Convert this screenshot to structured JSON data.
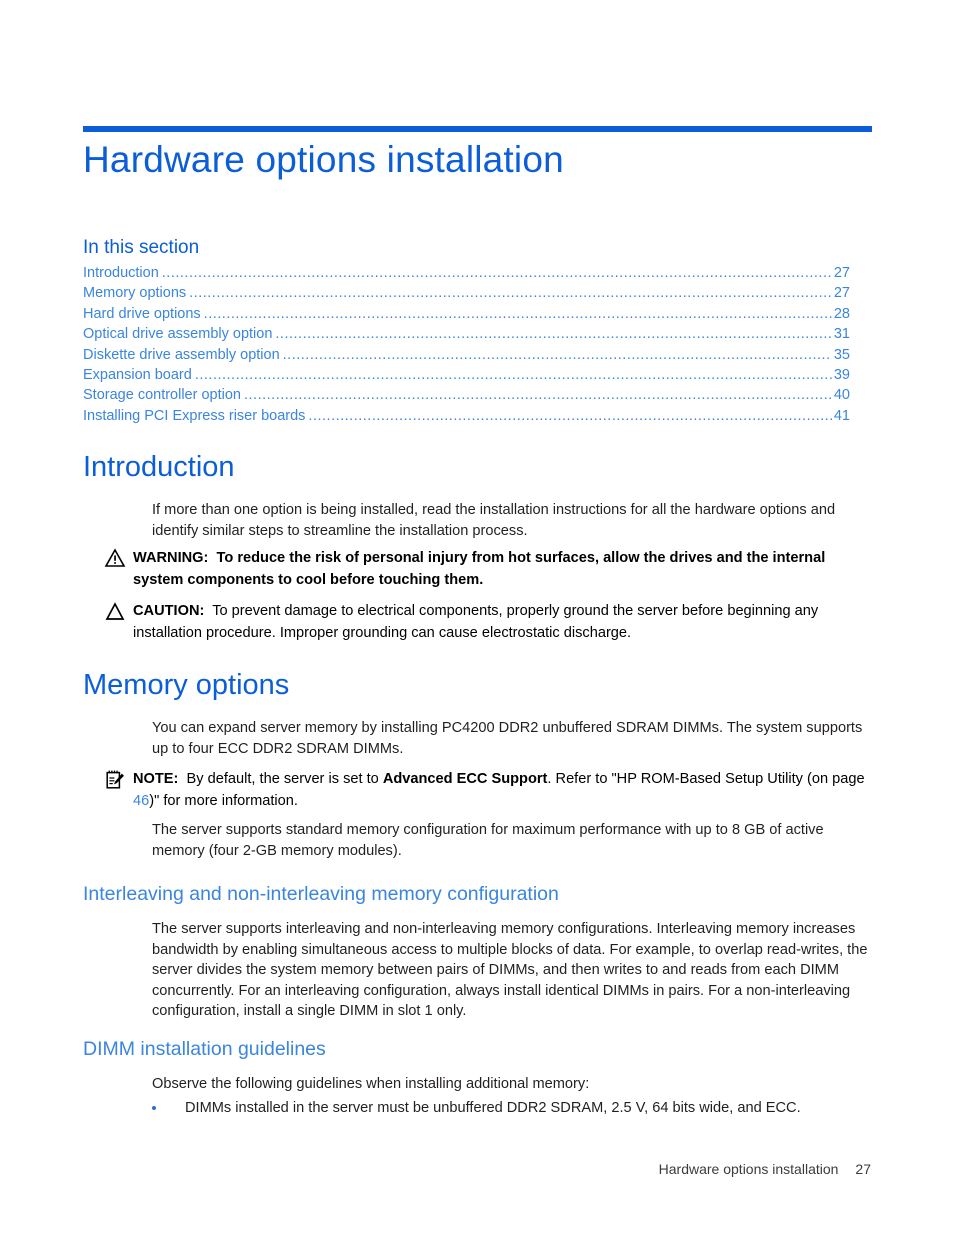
{
  "document": {
    "chapter_title": "Hardware options installation",
    "footer": {
      "title": "Hardware options installation",
      "page_number": "27"
    },
    "colors": {
      "brand_blue": "#0b5ed7",
      "link_blue": "#3a85dd",
      "body_black": "#231f20"
    }
  },
  "in_this_section": {
    "heading": "In this section",
    "entries": [
      {
        "label": "Introduction",
        "page": "27"
      },
      {
        "label": "Memory options",
        "page": "27"
      },
      {
        "label": "Hard drive options",
        "page": "28"
      },
      {
        "label": "Optical drive assembly option",
        "page": "31"
      },
      {
        "label": "Diskette drive assembly option",
        "page": "35"
      },
      {
        "label": "Expansion board",
        "page": "39"
      },
      {
        "label": "Storage controller option",
        "page": "40"
      },
      {
        "label": "Installing PCI Express riser boards",
        "page": "41"
      }
    ],
    "dot_leader": "........................................................................................................................................................................................................"
  },
  "introduction": {
    "heading": "Introduction",
    "paragraph": "If more than one option is being installed, read the installation instructions for all the hardware options and identify similar steps to streamline the installation process.",
    "warning": {
      "icon": "warning-triangle-exclamation-icon",
      "label": "WARNING:",
      "text": "To reduce the risk of personal injury from hot surfaces, allow the drives and the internal system components to cool before touching them."
    },
    "caution": {
      "icon": "caution-triangle-icon",
      "label": "CAUTION:",
      "text": "To prevent damage to electrical components, properly ground the server before beginning any installation procedure. Improper grounding can cause electrostatic discharge."
    }
  },
  "memory_options": {
    "heading": "Memory options",
    "paragraph_1": "You can expand server memory by installing PC4200 DDR2 unbuffered SDRAM DIMMs. The system supports up to four ECC DDR2 SDRAM DIMMs.",
    "note": {
      "icon": "note-notepad-pencil-icon",
      "label": "NOTE:",
      "text_before_bold": "By default, the server is set to ",
      "bold_text": "Advanced ECC Support",
      "text_after_bold": ". Refer to \"HP ROM-Based Setup Utility (on page ",
      "page_link": "46",
      "text_end": ")\" for more information."
    },
    "paragraph_2": "The server supports standard memory configuration for maximum performance with up to 8 GB of active memory (four 2-GB memory modules)."
  },
  "interleaving": {
    "heading": "Interleaving and non-interleaving memory configuration",
    "paragraph": "The server supports interleaving and non-interleaving memory configurations. Interleaving memory increases bandwidth by enabling simultaneous access to multiple blocks of data. For example, to overlap read-writes, the server divides the system memory between pairs of DIMMs, and then writes to and reads from each DIMM concurrently. For an interleaving configuration, always install identical DIMMs in pairs. For a non-interleaving configuration, install a single DIMM in slot 1 only."
  },
  "dimm_guidelines": {
    "heading": "DIMM installation guidelines",
    "intro": "Observe the following guidelines when installing additional memory:",
    "bullets": [
      "DIMMs installed in the server must be unbuffered DDR2 SDRAM, 2.5 V, 64 bits wide, and ECC."
    ]
  }
}
